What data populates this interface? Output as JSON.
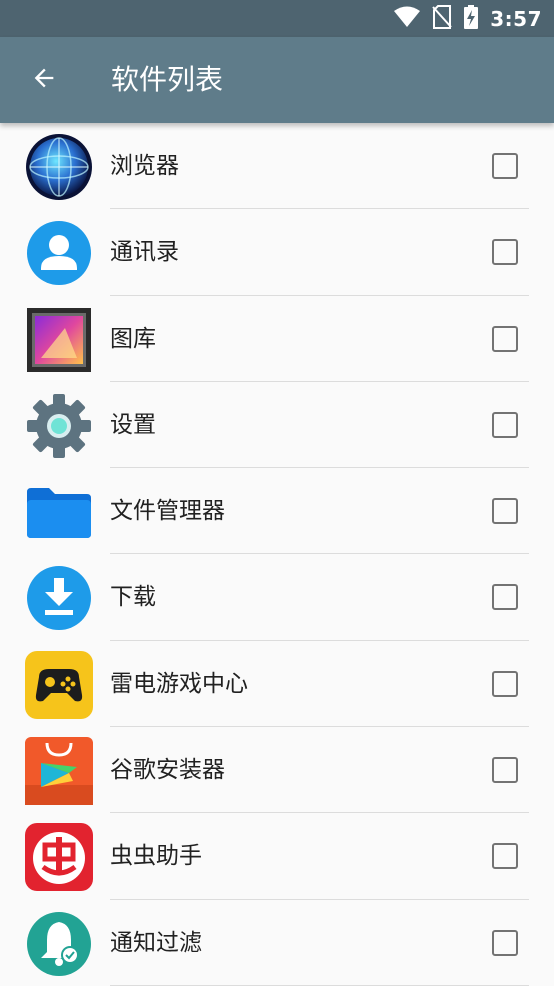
{
  "status": {
    "time": "3:57",
    "icons": [
      "wifi-icon",
      "no-sim-icon",
      "battery-charging-icon"
    ]
  },
  "toolbar": {
    "title": "软件列表",
    "back_icon": "arrow-left-icon"
  },
  "apps": [
    {
      "label": "浏览器",
      "icon": "browser-globe-icon",
      "checked": false
    },
    {
      "label": "通讯录",
      "icon": "contacts-icon",
      "checked": false
    },
    {
      "label": "图库",
      "icon": "gallery-icon",
      "checked": false
    },
    {
      "label": "设置",
      "icon": "settings-gear-icon",
      "checked": false
    },
    {
      "label": "文件管理器",
      "icon": "folder-icon",
      "checked": false
    },
    {
      "label": "下载",
      "icon": "download-icon",
      "checked": false
    },
    {
      "label": "雷电游戏中心",
      "icon": "gamepad-icon",
      "checked": false
    },
    {
      "label": "谷歌安装器",
      "icon": "google-installer-icon",
      "checked": false
    },
    {
      "label": "虫虫助手",
      "icon": "chongchong-icon",
      "checked": false
    },
    {
      "label": "通知过滤",
      "icon": "notification-filter-icon",
      "checked": false
    }
  ],
  "colors": {
    "statusbar": "#4e6470",
    "toolbar": "#5f7c8a",
    "background": "#fafafa"
  }
}
